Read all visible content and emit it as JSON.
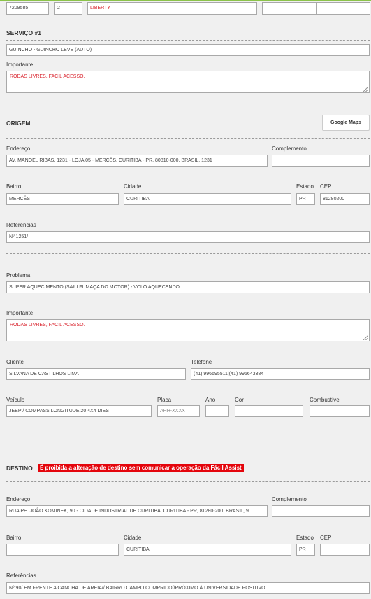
{
  "top_row": {
    "code": "7209585",
    "number": "2",
    "insurer": "LIBERTY",
    "extra1": "",
    "extra2": ""
  },
  "servico": {
    "title": "SERVIÇO #1",
    "service": "GUINCHO - GUINCHO LEVE (AUTO)",
    "important_label": "Importante",
    "important_value": "RODAS LIVRES, FACIL ACESSO."
  },
  "origem": {
    "title": "ORIGEM",
    "maps_button": "Google Maps",
    "endereco_label": "Endereço",
    "endereco": "AV. MANOEL RIBAS, 1231 - LOJA 05 - MERCÊS, CURITIBA - PR, 80810-000, BRASIL, 1231",
    "complemento_label": "Complemento",
    "complemento": "",
    "bairro_label": "Bairro",
    "bairro": "MERCÊS",
    "cidade_label": "Cidade",
    "cidade": "CURITIBA",
    "estado_label": "Estado",
    "estado": "PR",
    "cep_label": "CEP",
    "cep": "81280200",
    "referencias_label": "Referências",
    "referencias": "Nº 1251/"
  },
  "detalhes": {
    "problema_label": "Problema",
    "problema": "SUPER AQUECIMENTO (SAIU FUMAÇA DO MOTOR) - VCLO AQUECENDO",
    "important_label": "Importante",
    "important_value": "RODAS LIVRES, FACIL ACESSO.",
    "cliente_label": "Cliente",
    "cliente": "SILVANA DE CASTILHOS LIMA",
    "telefone_label": "Telefone",
    "telefone": "(41) 996695511|(41) 995643384",
    "veiculo_label": "Veículo",
    "veiculo": "JEEP / COMPASS LONGITUDE 20 4X4 DIES",
    "placa_label": "Placa",
    "placa_placeholder": "AHH-XXXX",
    "ano_label": "Ano",
    "ano": "",
    "cor_label": "Cor",
    "cor": "",
    "combustivel_label": "Combustível",
    "combustivel": ""
  },
  "destino": {
    "title": "DESTINO",
    "warning": "É proibida a alteração de destino sem comunicar a operação da Fácil Assist",
    "endereco_label": "Endereço",
    "endereco": "RUA PE. JOÃO KOMINEK, 90 - CIDADE INDUSTRIAL DE CURITIBA, CURITIBA - PR, 81280-200, BRASIL, 9",
    "complemento_label": "Complemento",
    "complemento": "",
    "bairro_label": "Bairro",
    "bairro": "",
    "cidade_label": "Cidade",
    "cidade": "CURITIBA",
    "estado_label": "Estado",
    "estado": "PR",
    "cep_label": "CEP",
    "cep": "",
    "referencias_label": "Referências",
    "referencias": "Nº 90/ EM FRENTE A CANCHA DE AREIA// BAIRRO CAMPO COMPRIDO//PRÓXIMO À UNIVERSIDADE POSITIVO"
  },
  "colors": {
    "warning_bg": "#e4050c",
    "accent_red_text": "#d9232d",
    "top_line": "#8bc34a"
  }
}
